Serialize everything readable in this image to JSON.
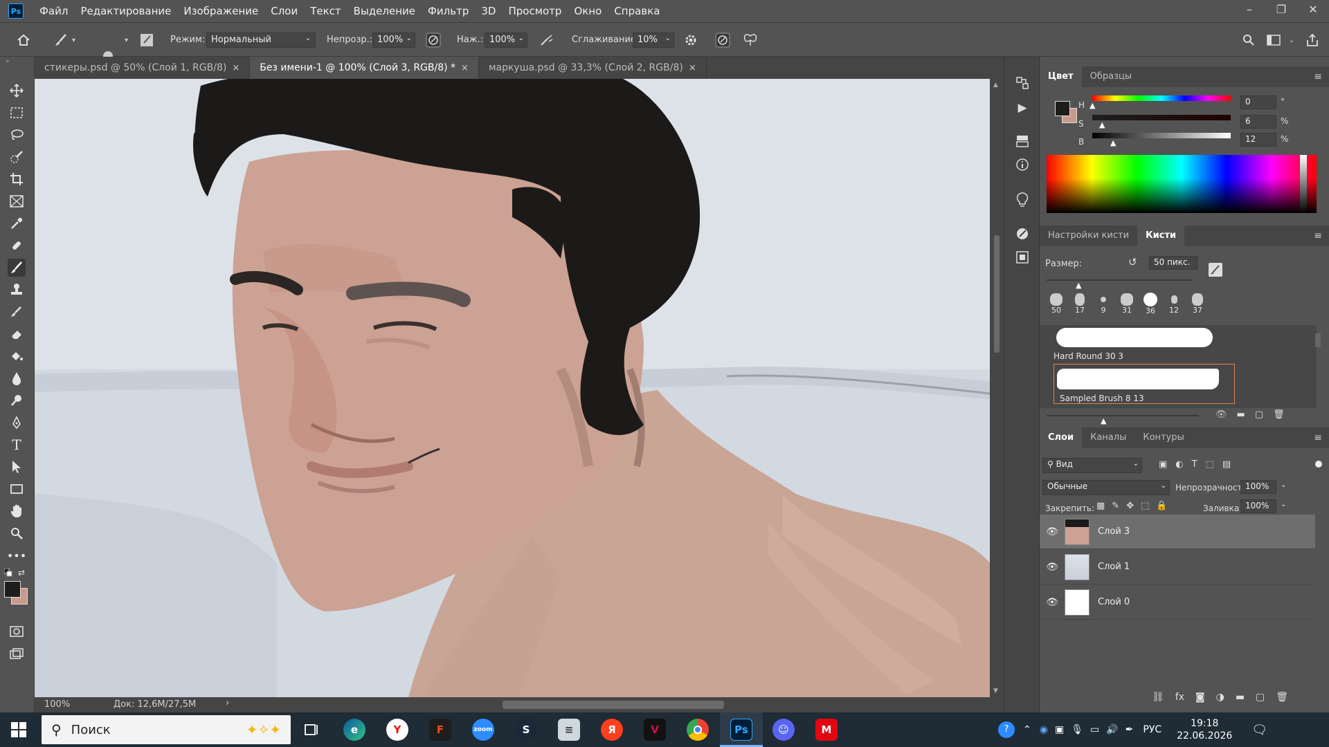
{
  "app": {
    "logo": "Ps"
  },
  "menu": [
    "Файл",
    "Редактирование",
    "Изображение",
    "Слои",
    "Текст",
    "Выделение",
    "Фильтр",
    "3D",
    "Просмотр",
    "Окно",
    "Справка"
  ],
  "window_controls": {
    "minimize": "–",
    "restore": "❐",
    "close": "✕"
  },
  "options": {
    "brush_size": "50",
    "mode_label": "Режим:",
    "mode_value": "Нормальный",
    "opacity_label": "Непрозр.:",
    "opacity_value": "100%",
    "pressure_label": "Наж.:",
    "pressure_value": "100%",
    "smoothing_label": "Сглаживание:",
    "smoothing_value": "10%"
  },
  "tabs": [
    {
      "label": "стикеры.psd @ 50% (Слой 1, RGB/8)",
      "close": "×"
    },
    {
      "label": "Без имени-1 @ 100% (Слой 3, RGB/8) *",
      "close": "×"
    },
    {
      "label": "маркуша.psd @ 33,3% (Слой 2, RGB/8)",
      "close": "×"
    }
  ],
  "status": {
    "zoom": "100%",
    "doc": "Док: 12,6M/27,5M",
    "arrow": "›"
  },
  "color_panel": {
    "tabs": [
      "Цвет",
      "Образцы"
    ],
    "h_label": "H",
    "h_value": "0",
    "h_unit": "°",
    "s_label": "S",
    "s_value": "6",
    "s_unit": "%",
    "b_label": "B",
    "b_value": "12",
    "b_unit": "%",
    "foreground": "#1f1d1c",
    "background": "#c99a8c"
  },
  "brush_panel": {
    "tabs": [
      "Настройки кисти",
      "Кисти"
    ],
    "size_label": "Размер:",
    "size_value": "50 пикс.",
    "presets": [
      "50",
      "17",
      "9",
      "31",
      "36",
      "12",
      "37"
    ],
    "brushes": [
      "Hard Round 30 3",
      "Sampled Brush 8 13"
    ]
  },
  "layers_panel": {
    "tabs": [
      "Слои",
      "Каналы",
      "Контуры"
    ],
    "filter": "Вид",
    "blend": "Обычные",
    "opacity_label": "Непрозрачность:",
    "opacity_value": "100%",
    "lock_label": "Закрепить:",
    "fill_label": "Заливка:",
    "fill_value": "100%",
    "layers": [
      {
        "name": "Слой 3",
        "selected": true
      },
      {
        "name": "Слой 1",
        "selected": false
      },
      {
        "name": "Слой 0",
        "selected": false
      }
    ]
  },
  "taskbar": {
    "search_placeholder": "Поиск",
    "lang": "РУС",
    "time": "19:18",
    "date": "22.06.2026",
    "apps": [
      "task-view",
      "edge",
      "yandex-browser",
      "figma",
      "zoom",
      "steam",
      "notepad",
      "yandex",
      "vk",
      "chrome",
      "photoshop",
      "discord",
      "mts"
    ]
  }
}
